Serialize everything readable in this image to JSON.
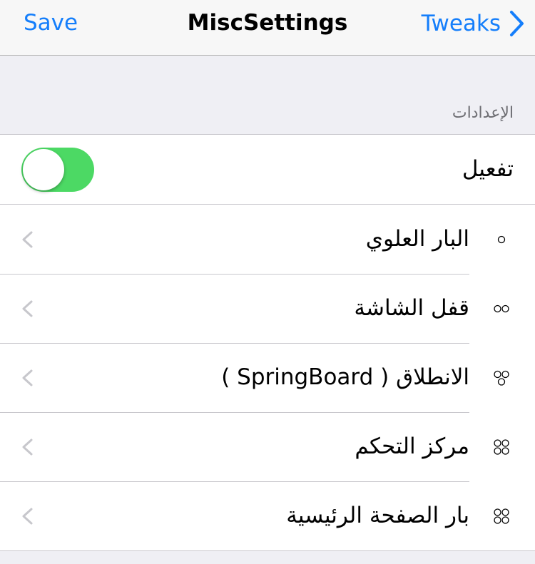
{
  "navbar": {
    "left_label": "Save",
    "title": "MiscSettings",
    "right_label": "Tweaks"
  },
  "section": {
    "header": "الإعدادات"
  },
  "toggle_row": {
    "label": "تفعيل",
    "enabled": true
  },
  "rows": [
    {
      "label": "البار العلوي",
      "icon": "one-circle-icon"
    },
    {
      "label": "قفل الشاشة",
      "icon": "two-circles-icon"
    },
    {
      "label": "الانطلاق ( SpringBoard )",
      "icon": "three-circles-icon"
    },
    {
      "label": "مركز التحكم",
      "icon": "four-circles-icon"
    },
    {
      "label": "بار الصفحة الرئيسية",
      "icon": "four-circles-icon"
    }
  ],
  "colors": {
    "accent": "#147efb",
    "toggle_on": "#4cd964",
    "background": "#efeff4",
    "separator": "#c8c7cc"
  }
}
